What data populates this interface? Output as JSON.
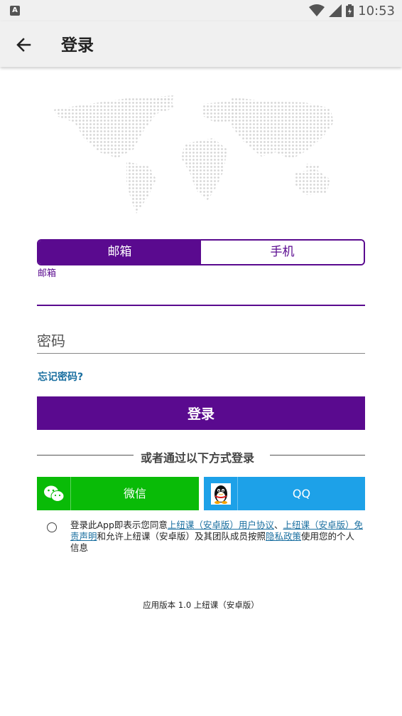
{
  "statusbar": {
    "time": "10:53",
    "app_icon_letter": "A"
  },
  "appbar": {
    "title": "登录"
  },
  "tabs": {
    "email": "邮箱",
    "phone": "手机"
  },
  "email_field": {
    "label": "邮箱",
    "value": ""
  },
  "password_field": {
    "placeholder": "密码"
  },
  "forgot_password": "忘记密码?",
  "login_button": "登录",
  "divider_text": "或者通过以下方式登录",
  "social": {
    "wechat_label": "微信",
    "qq_label": "QQ"
  },
  "agreement": {
    "part1": "登录此App即表示您同意",
    "link1": "上纽课（安卓版）用户协议",
    "sep": "、",
    "link2": "上纽课（安卓版）免责声明",
    "part2": "和允许上纽课（安卓版）及其团队成员按照",
    "link3": "隐私政策",
    "part3": "使用您的个人信息"
  },
  "version": "应用版本 1.0 上纽课（安卓版）",
  "colors": {
    "primary": "#5a0a8f",
    "link": "#1a6fa0",
    "wechat": "#09bb07",
    "qq": "#1da1e8"
  }
}
